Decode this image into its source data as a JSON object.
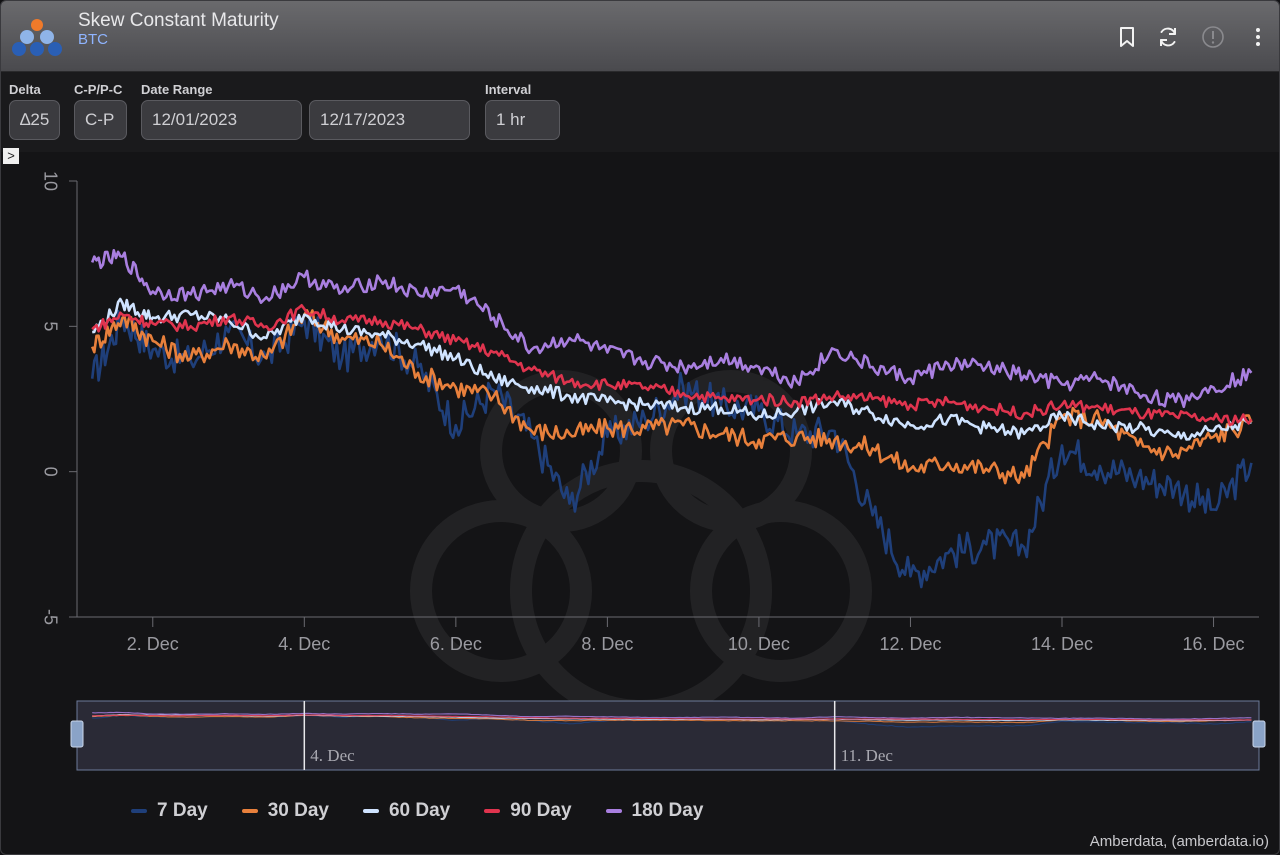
{
  "header": {
    "title": "Skew Constant Maturity",
    "subtitle": "BTC",
    "icons": [
      "bookmark-icon",
      "refresh-icon",
      "alert-icon",
      "more-vertical-icon"
    ]
  },
  "controls": {
    "delta_label": "Delta",
    "delta_value": "∆25",
    "cp_label": "C-P/P-C",
    "cp_value": "C-P",
    "date_range_label": "Date Range",
    "date_start": "12/01/2023",
    "date_end": "12/17/2023",
    "interval_label": "Interval",
    "interval_value": "1 hr",
    "toggle_glyph": ">"
  },
  "chart_data": {
    "type": "line",
    "x_ticks": [
      "2. Dec",
      "4. Dec",
      "6. Dec",
      "8. Dec",
      "10. Dec",
      "12. Dec",
      "14. Dec",
      "16. Dec"
    ],
    "x_tick_days": [
      2,
      4,
      6,
      8,
      10,
      12,
      14,
      16
    ],
    "xlim": [
      1.0,
      16.6
    ],
    "y_ticks": [
      "10",
      "5",
      "0",
      "-5"
    ],
    "y_tick_values": [
      10,
      5,
      0,
      -5
    ],
    "ylim": [
      -5,
      10
    ],
    "grid": false,
    "legend_position": "bottom-left",
    "x": [
      1.2,
      1.6,
      2.0,
      2.5,
      3.0,
      3.5,
      4.0,
      4.5,
      5.0,
      5.5,
      6.0,
      6.5,
      7.0,
      7.5,
      8.0,
      8.5,
      9.0,
      9.5,
      10.0,
      10.5,
      11.0,
      11.5,
      12.0,
      12.5,
      13.0,
      13.5,
      14.0,
      14.5,
      15.0,
      15.5,
      16.0,
      16.5
    ],
    "series": [
      {
        "name": "7 Day",
        "color": "#1f3f7a",
        "values": [
          3.2,
          5.3,
          4.2,
          3.8,
          4.8,
          3.9,
          5.2,
          3.9,
          4.7,
          3.6,
          1.6,
          2.8,
          1.2,
          -1.1,
          1.2,
          1.8,
          2.9,
          2.3,
          2.1,
          1.3,
          1.4,
          -1.5,
          -3.6,
          -2.8,
          -2.5,
          -2.6,
          0.9,
          0.2,
          -0.2,
          -0.5,
          -1.3,
          0.3
        ]
      },
      {
        "name": "30 Day",
        "color": "#e8803c",
        "values": [
          4.3,
          5.3,
          4.5,
          3.9,
          4.4,
          3.9,
          5.4,
          4.6,
          4.4,
          3.4,
          2.9,
          2.6,
          1.4,
          1.3,
          1.5,
          1.5,
          1.6,
          1.3,
          1.1,
          1.2,
          1.1,
          0.8,
          0.1,
          0.3,
          0.1,
          -0.2,
          1.9,
          1.8,
          0.9,
          0.6,
          1.2,
          1.7
        ]
      },
      {
        "name": "60 Day",
        "color": "#cfe3ff",
        "values": [
          4.8,
          5.8,
          5.3,
          5.4,
          5.2,
          4.6,
          5.4,
          4.9,
          4.7,
          4.4,
          3.9,
          3.2,
          2.9,
          2.6,
          2.4,
          2.3,
          2.2,
          2.2,
          1.9,
          2.1,
          2.4,
          2.0,
          1.6,
          1.8,
          1.5,
          1.3,
          1.9,
          1.6,
          1.5,
          1.2,
          1.4,
          1.7
        ]
      },
      {
        "name": "90 Day",
        "color": "#e0344e",
        "values": [
          4.9,
          5.4,
          5.1,
          5.0,
          5.3,
          5.0,
          5.6,
          5.2,
          5.2,
          4.9,
          4.5,
          4.1,
          3.5,
          3.1,
          3.0,
          2.9,
          2.7,
          2.5,
          2.5,
          2.4,
          2.6,
          2.5,
          2.3,
          2.4,
          2.2,
          2.0,
          2.3,
          2.2,
          2.0,
          1.9,
          1.8,
          1.8
        ]
      },
      {
        "name": "180 Day",
        "color": "#a97fe0",
        "values": [
          7.2,
          7.4,
          6.2,
          6.1,
          6.4,
          6.0,
          6.7,
          6.2,
          6.6,
          6.1,
          6.3,
          5.3,
          4.2,
          4.6,
          4.1,
          3.8,
          3.6,
          3.9,
          3.6,
          3.1,
          4.2,
          3.6,
          3.2,
          3.7,
          3.6,
          3.3,
          3.0,
          3.2,
          2.7,
          2.4,
          2.9,
          3.4
        ]
      }
    ],
    "navigator": {
      "labels": [
        "4. Dec",
        "11. Dec"
      ],
      "label_days": [
        4,
        11
      ]
    }
  },
  "credit": "Amberdata, (amberdata.io)"
}
